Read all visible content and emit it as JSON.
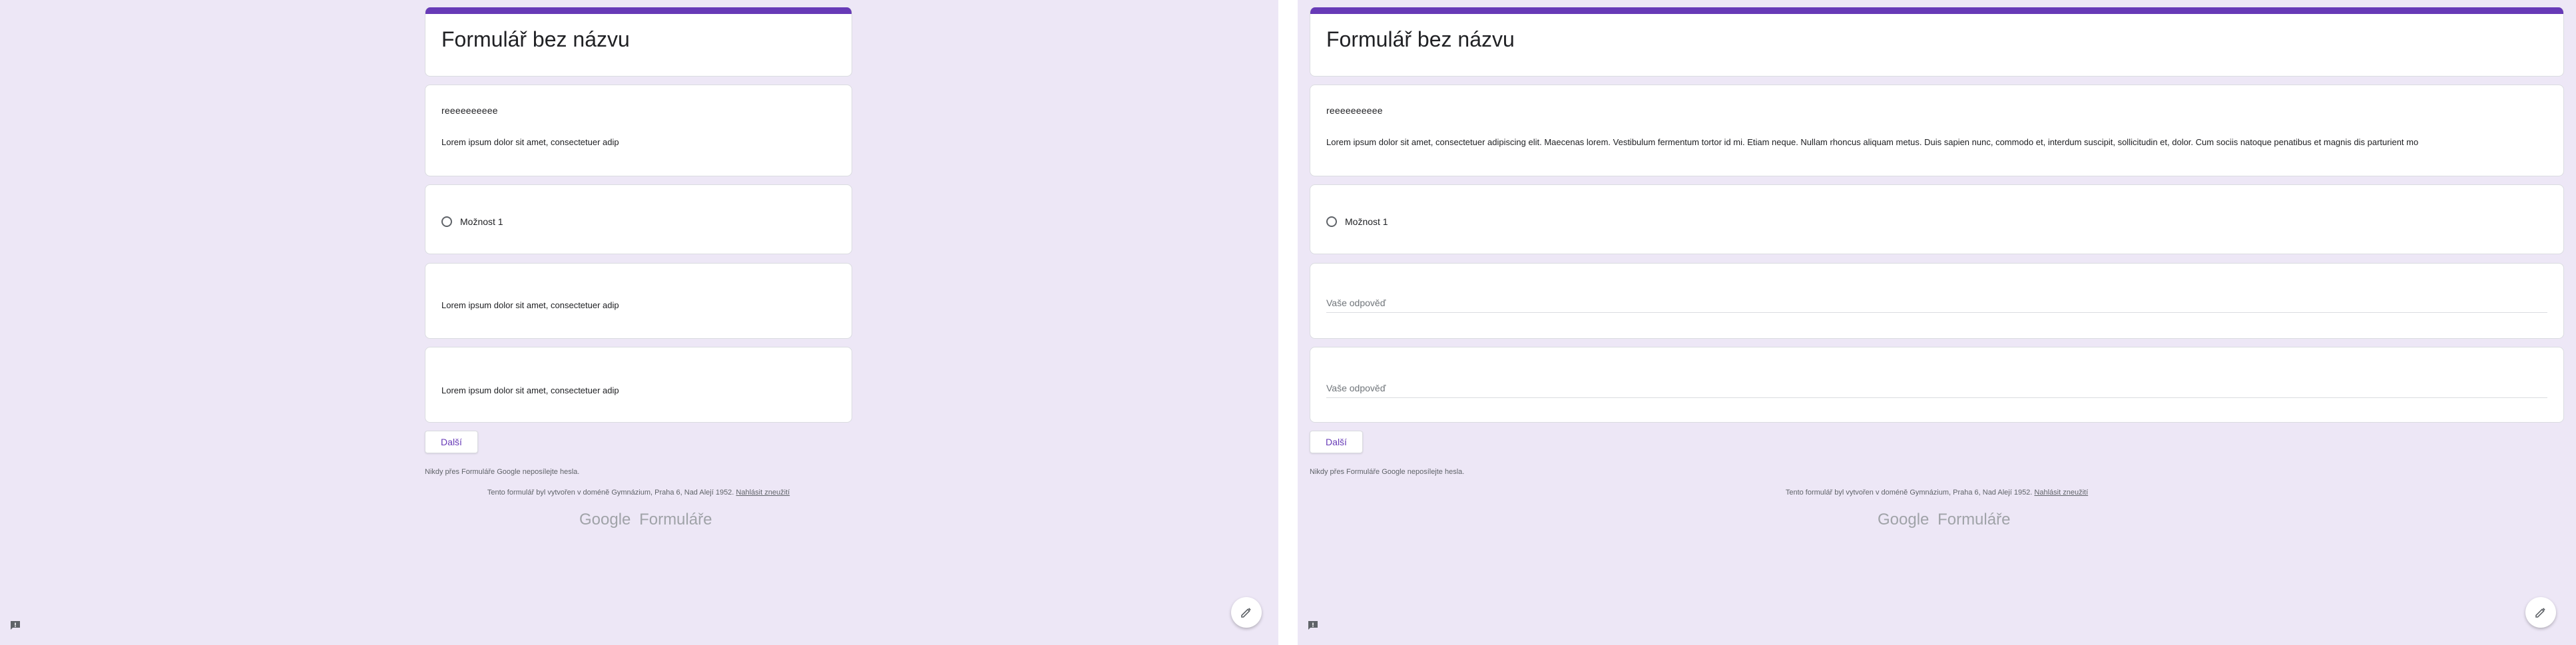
{
  "form": {
    "title": "Formulář bez názvu",
    "question_title": "reeeeeeeeee",
    "description_full": "Lorem ipsum dolor sit amet, consectetuer adipiscing elit. Maecenas lorem. Vestibulum fermentum tortor id mi. Etiam neque. Nullam rhoncus aliquam metus. Duis sapien nunc, commodo et, interdum suscipit, sollicitudin et, dolor. Cum sociis natoque penatibus et magnis dis parturient mo",
    "description_truncated": "Lorem ipsum dolor sit amet, consectetuer adip",
    "radio_option": "Možnost 1",
    "answer_placeholder": "Vaše odpověď",
    "next_button": "Další",
    "password_note": "Nikdy přes Formuláře Google neposílejte hesla.",
    "footer_text": "Tento formulář byl vytvořen v doméně Gymnázium, Praha 6, Nad Alejí 1952.",
    "footer_link": "Nahlásit zneužití",
    "logo_google": "Google",
    "logo_product": "Formuláře"
  },
  "colors": {
    "accent": "#673ab7",
    "background": "#ede7f6"
  },
  "icons": {
    "fab": "pencil-icon",
    "report": "feedback-icon"
  }
}
